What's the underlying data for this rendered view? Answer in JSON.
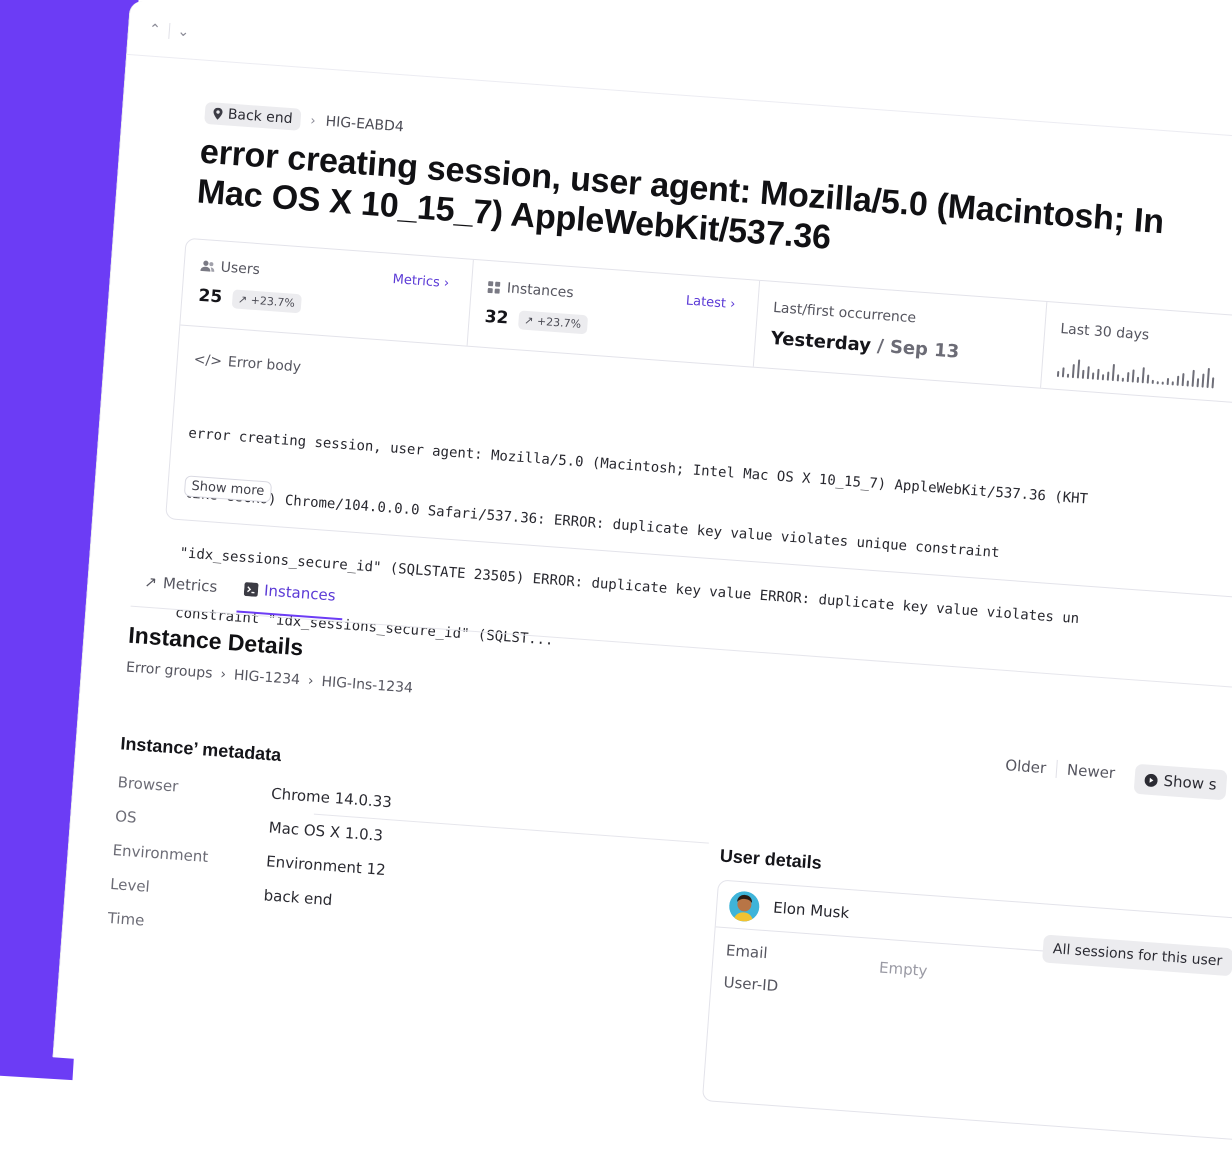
{
  "topbar": {
    "up_icon": "chevron-up-icon",
    "down_icon": "chevron-down-icon"
  },
  "breadcrumb": {
    "project": "Back end",
    "error_id": "HIG-EABD4"
  },
  "title_lines": [
    "error creating session, user agent: Mozilla/5.0 (Macintosh; In",
    "Mac OS X 10_15_7) AppleWebKit/537.36"
  ],
  "summary": {
    "users": {
      "label": "Users",
      "value": "25",
      "trend": "+23.7%",
      "link": "Metrics"
    },
    "instances": {
      "label": "Instances",
      "value": "32",
      "trend": "+23.7%",
      "link": "Latest"
    },
    "occurrence": {
      "label": "Last/first occurrence",
      "last": "Yesterday",
      "separator": "/",
      "first": "Sep 13"
    },
    "last30": {
      "label": "Last 30 days",
      "sparkline": [
        4,
        7,
        3,
        10,
        13,
        6,
        9,
        5,
        8,
        4,
        6,
        12,
        5,
        3,
        7,
        9,
        4,
        11,
        6,
        3,
        2,
        2,
        5,
        3,
        7,
        9,
        4,
        12,
        6,
        10,
        14,
        8
      ]
    }
  },
  "error_body": {
    "label": "Error body",
    "lines": [
      "error creating session, user agent: Mozilla/5.0 (Macintosh; Intel Mac OS X 10_15_7) AppleWebKit/537.36 (KHT",
      "like Gecko) Chrome/104.0.0.0 Safari/537.36: ERROR: duplicate key value violates unique constraint",
      "\"idx_sessions_secure_id\" (SQLSTATE 23505) ERROR: duplicate key value ERROR: duplicate key value violates un",
      "constraint \"idx_sessions_secure_id\" (SQLST..."
    ],
    "show_more": "Show more"
  },
  "tabs": [
    {
      "label": "Metrics"
    },
    {
      "label": "Instances",
      "active": true
    }
  ],
  "instance": {
    "title": "Instance Details",
    "crumbs": [
      "Error groups",
      "HIG-1234",
      "HIG-Ins-1234"
    ],
    "older": "Older",
    "newer": "Newer",
    "show_button": "Show s"
  },
  "metadata": {
    "title": "Instance’ metadata",
    "rows": [
      {
        "key": "Browser",
        "value": "Chrome 14.0.33"
      },
      {
        "key": "OS",
        "value": "Mac OS X 1.0.3"
      },
      {
        "key": "Environment",
        "value": "Environment 12"
      },
      {
        "key": "Level",
        "value": "back end"
      },
      {
        "key": "Time",
        "value": ""
      }
    ]
  },
  "user": {
    "title": "User details",
    "name": "Elon Musk",
    "sessions_button": "All sessions for this user",
    "email_label": "Email",
    "email_value": "Empty",
    "userid_label": "User-ID"
  },
  "colors": {
    "accent": "#6c3cf5",
    "link": "#5b3ad6"
  }
}
